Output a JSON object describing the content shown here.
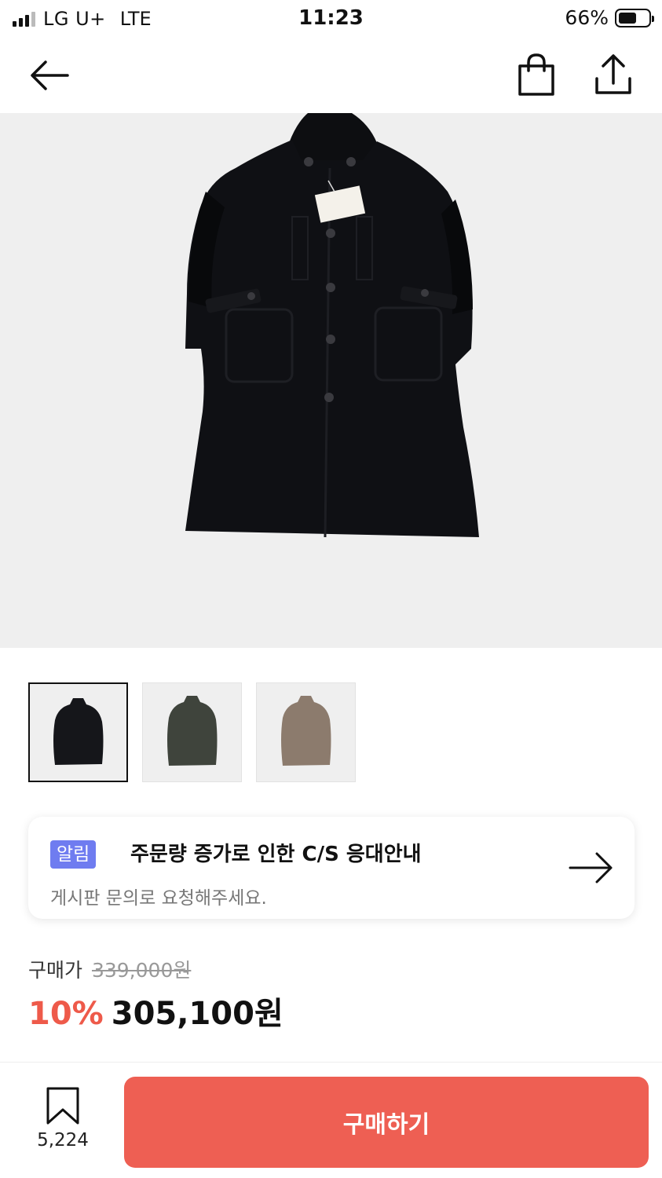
{
  "status_bar": {
    "carrier": "LG U+",
    "network": "LTE",
    "time": "11:23",
    "battery": "66%"
  },
  "nav": {
    "back_icon": "arrow-left-icon",
    "cart_icon": "shopping-bag-icon",
    "share_icon": "share-icon"
  },
  "product": {
    "image": "black wool coat",
    "thumbnails": [
      {
        "color": "#1a1c20",
        "selected": true
      },
      {
        "color": "#3e433b",
        "selected": false
      },
      {
        "color": "#8c7b6d",
        "selected": false
      }
    ]
  },
  "notice": {
    "badge": "알림",
    "title": "주문량 증가로 인한 C/S 응대안내",
    "subtitle": "게시판 문의로 요청해주세요."
  },
  "price": {
    "label": "구매가",
    "original": "339,000원",
    "discount": "10%",
    "final": "305,100원"
  },
  "bottom": {
    "bookmark_count": "5,224",
    "buy_label": "구매하기"
  },
  "colors": {
    "accent": "#ee5f53",
    "discount": "#ee5a4a",
    "badge": "#6f7cf0"
  }
}
